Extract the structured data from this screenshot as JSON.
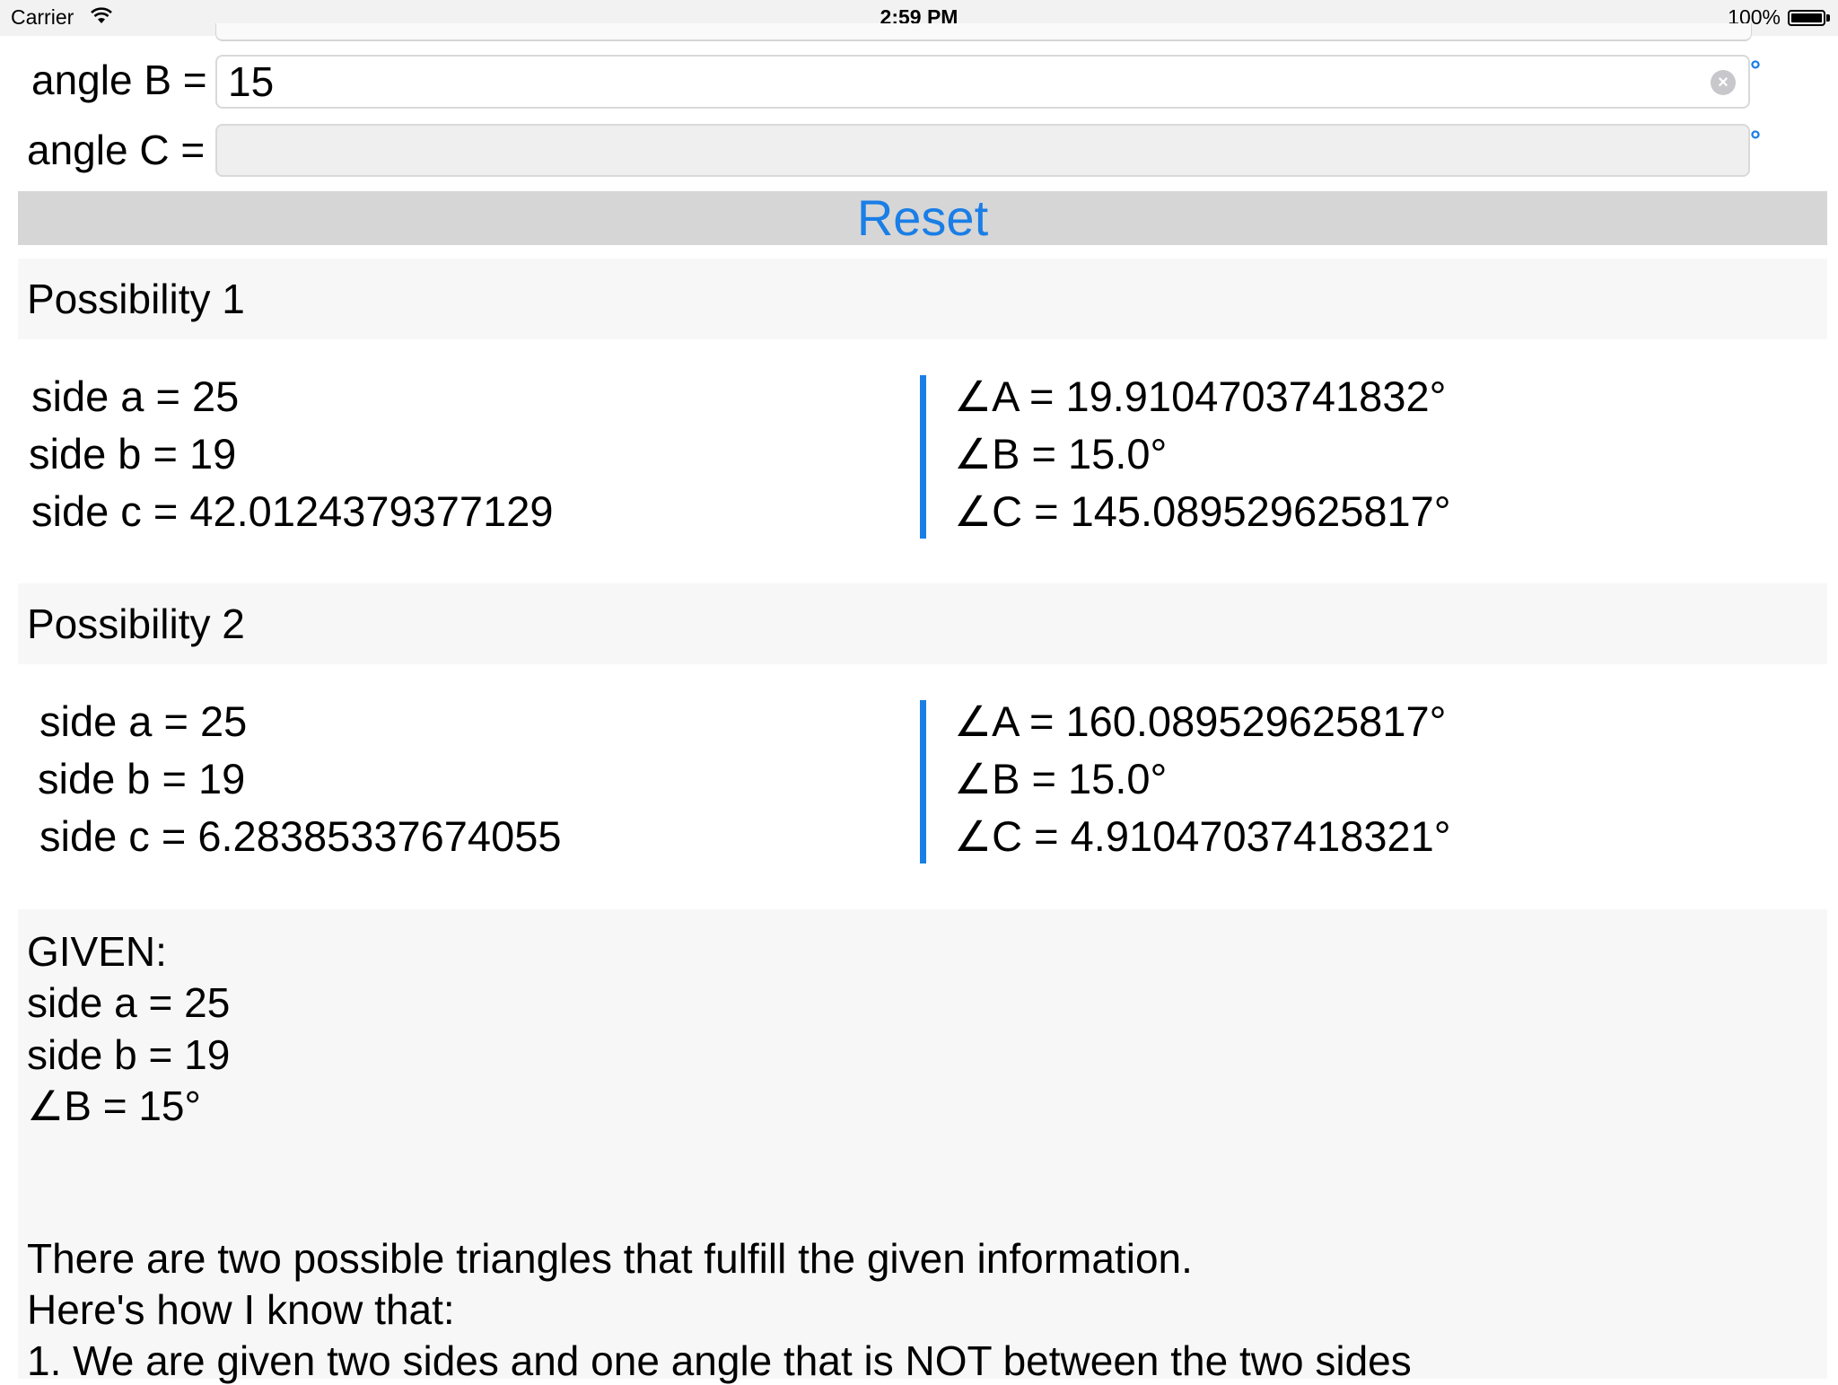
{
  "status_bar": {
    "carrier": "Carrier",
    "time": "2:59 PM",
    "battery": "100%"
  },
  "inputs": {
    "angle_b": {
      "label": "angle B =",
      "value": "15",
      "unit": "°"
    },
    "angle_c": {
      "label": "angle C =",
      "value": "",
      "unit": "°"
    }
  },
  "reset_label": "Reset",
  "possibility1": {
    "title": "Possibility 1",
    "side_a": "side a = 25",
    "side_b": "side b = 19",
    "side_c": "side c = 42.0124379377129",
    "angle_a": "∠A = 19.9104703741832°",
    "angle_b": "∠B = 15.0°",
    "angle_c": "∠C = 145.089529625817°"
  },
  "possibility2": {
    "title": "Possibility 2",
    "side_a": "side a = 25",
    "side_b": "side b = 19",
    "side_c": "side c = 6.28385337674055",
    "angle_a": "∠A = 160.089529625817°",
    "angle_b": "∠B = 15.0°",
    "angle_c": "∠C = 4.91047037418321°"
  },
  "explanation": {
    "given_head": "GIVEN:",
    "given_a": "side a = 25",
    "given_b": "side b = 19",
    "given_angle": "∠B = 15°",
    "line1": "There are two possible triangles that fulfill the given information.",
    "line2": "Here's how I know that:",
    "line3": "1. We are given two sides and one angle that is NOT between the two sides"
  },
  "colors": {
    "accent": "#1a7ee6",
    "section_bg": "#f7f7f7",
    "reset_bg": "#d6d6d6"
  }
}
